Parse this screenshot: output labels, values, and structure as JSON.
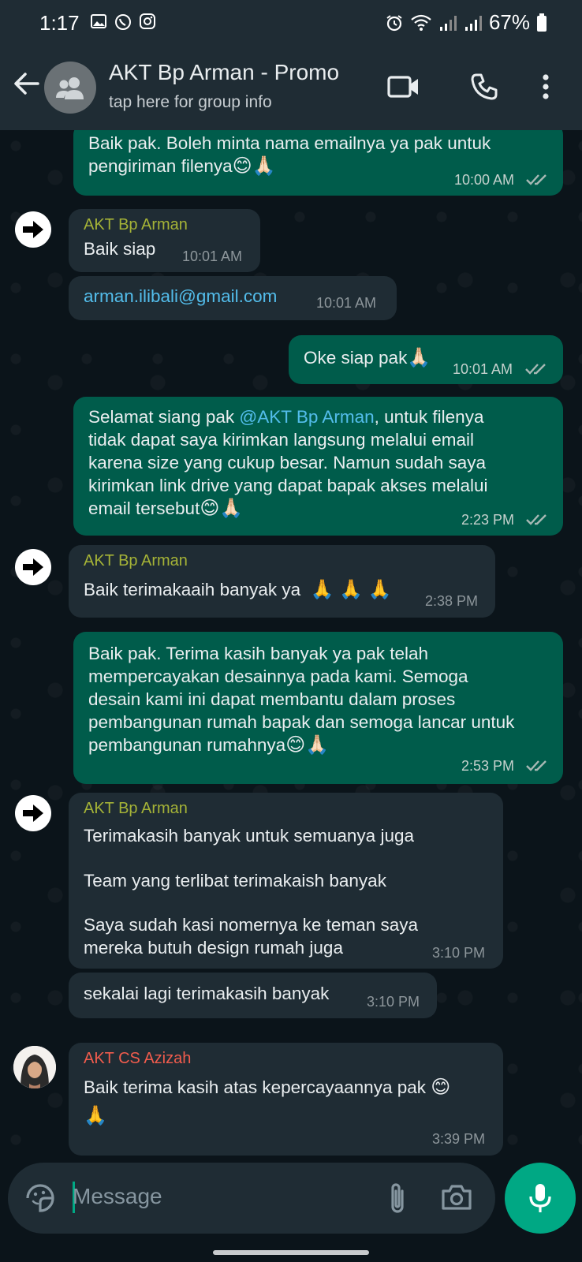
{
  "status": {
    "time": "1:17",
    "battery": "67%"
  },
  "header": {
    "title": "AKT Bp Arman - Promo",
    "subtitle": "tap here for group info"
  },
  "messages": [
    {
      "line1": "Baik pak. Boleh minta nama emailnya ya pak untuk",
      "line2": "pengiriman filenya",
      "emoji": "😊🙏🏻",
      "time": "10:00 AM"
    },
    {
      "sender": "AKT Bp Arman",
      "text": "Baik siap",
      "time": "10:01 AM"
    },
    {
      "link": "arman.ilibali@gmail.com",
      "time": "10:01 AM"
    },
    {
      "text": "Oke siap pak",
      "emoji": "🙏🏻",
      "time": "10:01 AM"
    },
    {
      "line1a": "Selamat siang pak ",
      "mention": "@AKT Bp Arman",
      "line1b": ", untuk filenya",
      "line2": "tidak dapat saya kirimkan langsung melalui email",
      "line3": "karena size yang cukup besar. Namun sudah saya",
      "line4": "kirimkan link drive yang dapat bapak akses melalui",
      "line5": "email tersebut",
      "emoji": "😊🙏🏻",
      "time": "2:23 PM"
    },
    {
      "sender": "AKT Bp Arman",
      "text": "Baik terimakaaih banyak ya",
      "emoji": "🙏 🙏 🙏",
      "time": "2:38 PM"
    },
    {
      "line1": "Baik pak. Terima kasih banyak ya pak telah",
      "line2": "mempercayakan desainnya pada kami. Semoga",
      "line3": "desain kami ini dapat membantu dalam proses",
      "line4": "pembangunan rumah bapak dan semoga lancar untuk",
      "line5": "pembangunan rumahnya",
      "emoji": "😊🙏🏻",
      "time": "2:53 PM"
    },
    {
      "sender": "AKT Bp Arman",
      "line1": "Terimakasih banyak untuk semuanya juga",
      "line2": "Team yang terlibat terimakaish banyak",
      "line3": "Saya sudah kasi nomernya ke teman saya",
      "line4": "mereka butuh design rumah juga",
      "time": "3:10 PM"
    },
    {
      "text": "sekalai lagi terimakasih banyak",
      "time": "3:10 PM"
    },
    {
      "sender": "AKT CS Azizah",
      "text": "Baik terima kasih atas kepercayaannya pak",
      "emoji1": "😊",
      "emoji2": "🙏",
      "time": "3:39 PM"
    }
  ],
  "composer": {
    "placeholder": "Message"
  },
  "colors": {
    "outgoing_bubble": "#005c4b",
    "incoming_bubble": "#1f2c34",
    "accent": "#00a884",
    "sender_arman": "#a5b337",
    "sender_azizah": "#f15c4d",
    "link": "#53bdeb"
  },
  "icons": [
    "back-arrow-icon",
    "group-avatar-icon",
    "video-call-icon",
    "phone-icon",
    "more-vert-icon",
    "forward-arrow-icon",
    "sticker-icon",
    "attach-icon",
    "camera-icon",
    "mic-icon"
  ]
}
